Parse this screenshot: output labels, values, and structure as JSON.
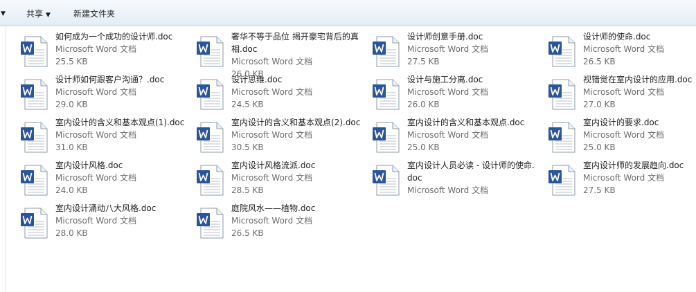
{
  "toolbar": {
    "share_label": "共享",
    "new_folder_label": "新建文件夹"
  },
  "files": [
    {
      "name": "如何成为一个成功的设计师.doc",
      "type": "Microsoft Word 文档",
      "size": "25.5 KB"
    },
    {
      "name": "奢华不等于品位 揭开豪宅背后的真相.doc",
      "type": "Microsoft Word 文档",
      "size": "26.0 KB"
    },
    {
      "name": "设计师创意手册.doc",
      "type": "Microsoft Word 文档",
      "size": "27.5 KB"
    },
    {
      "name": "设计师的使命.doc",
      "type": "Microsoft Word 文档",
      "size": "26.5 KB"
    },
    {
      "name": "设计师如何跟客户沟通？.doc",
      "type": "Microsoft Word 文档",
      "size": "29.0 KB"
    },
    {
      "name": "设计思维.doc",
      "type": "Microsoft Word 文档",
      "size": "24.5 KB"
    },
    {
      "name": "设计与施工分离.doc",
      "type": "Microsoft Word 文档",
      "size": "26.0 KB"
    },
    {
      "name": "视错觉在室内设计的应用.doc",
      "type": "Microsoft Word 文档",
      "size": "27.0 KB"
    },
    {
      "name": "室内设计的含义和基本观点(1).doc",
      "type": "Microsoft Word 文档",
      "size": "31.0 KB"
    },
    {
      "name": "室内设计的含义和基本观点(2).doc",
      "type": "Microsoft Word 文档",
      "size": "30.5 KB"
    },
    {
      "name": "室内设计的含义和基本观点.doc",
      "type": "Microsoft Word 文档",
      "size": "25.0 KB"
    },
    {
      "name": "室内设计的要求.doc",
      "type": "Microsoft Word 文档",
      "size": "25.0 KB"
    },
    {
      "name": "室内设计风格.doc",
      "type": "Microsoft Word 文档",
      "size": "24.0 KB"
    },
    {
      "name": "室内设计风格流派.doc",
      "type": "Microsoft Word 文档",
      "size": "28.5 KB"
    },
    {
      "name": "室内设计人员必读 - 设计师的使命.doc",
      "type": "Microsoft Word 文档",
      "size": ""
    },
    {
      "name": "室内设计师的发展趋向.doc",
      "type": "Microsoft Word 文档",
      "size": "27.5 KB"
    },
    {
      "name": "室内设计涌动八大风格.doc",
      "type": "Microsoft Word 文档",
      "size": "28.0 KB"
    },
    {
      "name": "庭院风水——植物.doc",
      "type": "Microsoft Word 文档",
      "size": "26.5 KB"
    }
  ]
}
